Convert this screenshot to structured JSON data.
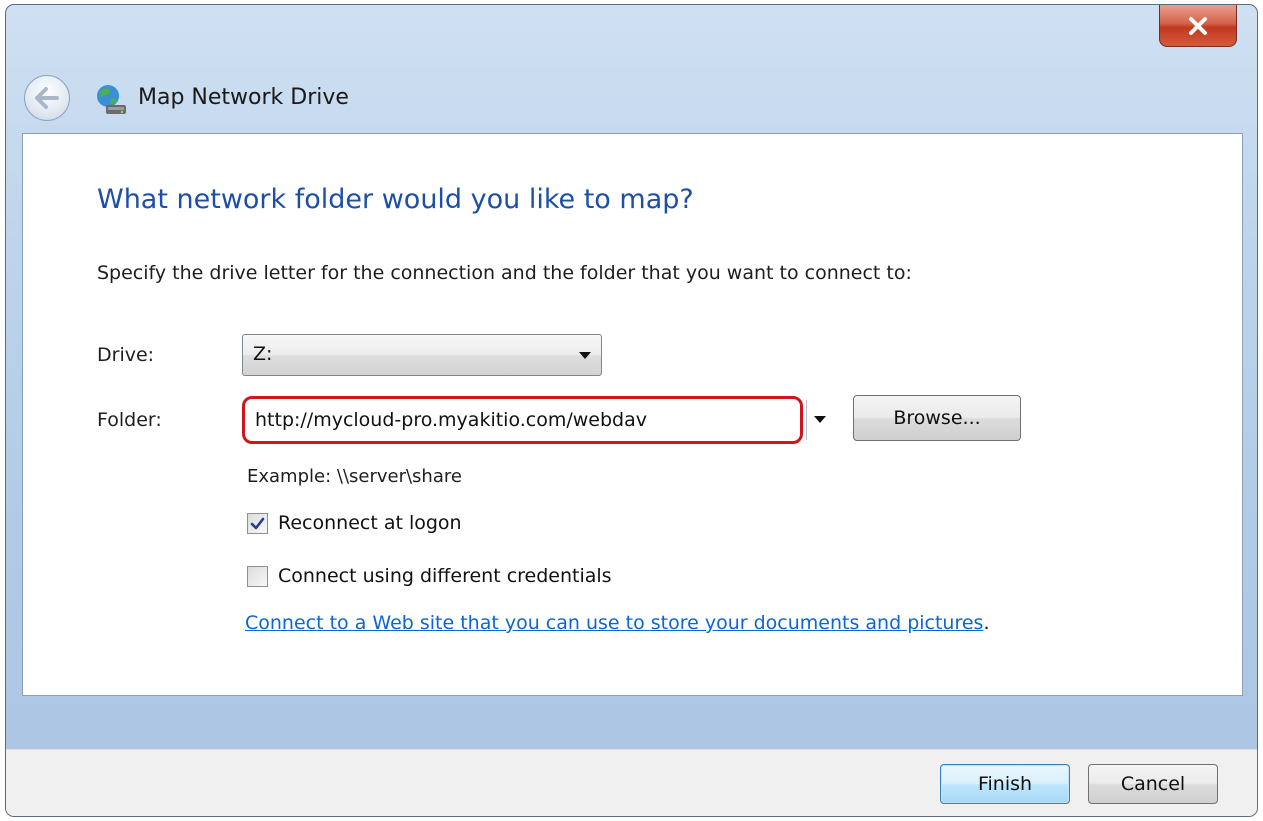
{
  "window": {
    "title": "Map Network Drive",
    "close_symbol": "x",
    "accent_color": "#1d4fa8",
    "highlight_color": "#d0161c"
  },
  "icons": {
    "back": "back-arrow-icon",
    "title": "network-drive-icon",
    "close": "close-icon",
    "dropdown": "chevron-down-icon",
    "check": "checkmark-icon"
  },
  "content": {
    "heading": "What network folder would you like to map?",
    "instruction": "Specify the drive letter for the connection and the folder that you want to connect to:",
    "drive_label": "Drive:",
    "drive_value": "Z:",
    "folder_label": "Folder:",
    "folder_value": "http://mycloud-pro.myakitio.com/webdav",
    "browse_label": "Browse...",
    "example_text": "Example: \\\\server\\share",
    "reconnect_label": "Reconnect at logon",
    "reconnect_checked": true,
    "credentials_label": "Connect using different credentials",
    "credentials_checked": false,
    "link_text": "Connect to a Web site that you can use to store your documents and pictures",
    "link_suffix": "."
  },
  "footer": {
    "finish_label": "Finish",
    "cancel_label": "Cancel"
  }
}
